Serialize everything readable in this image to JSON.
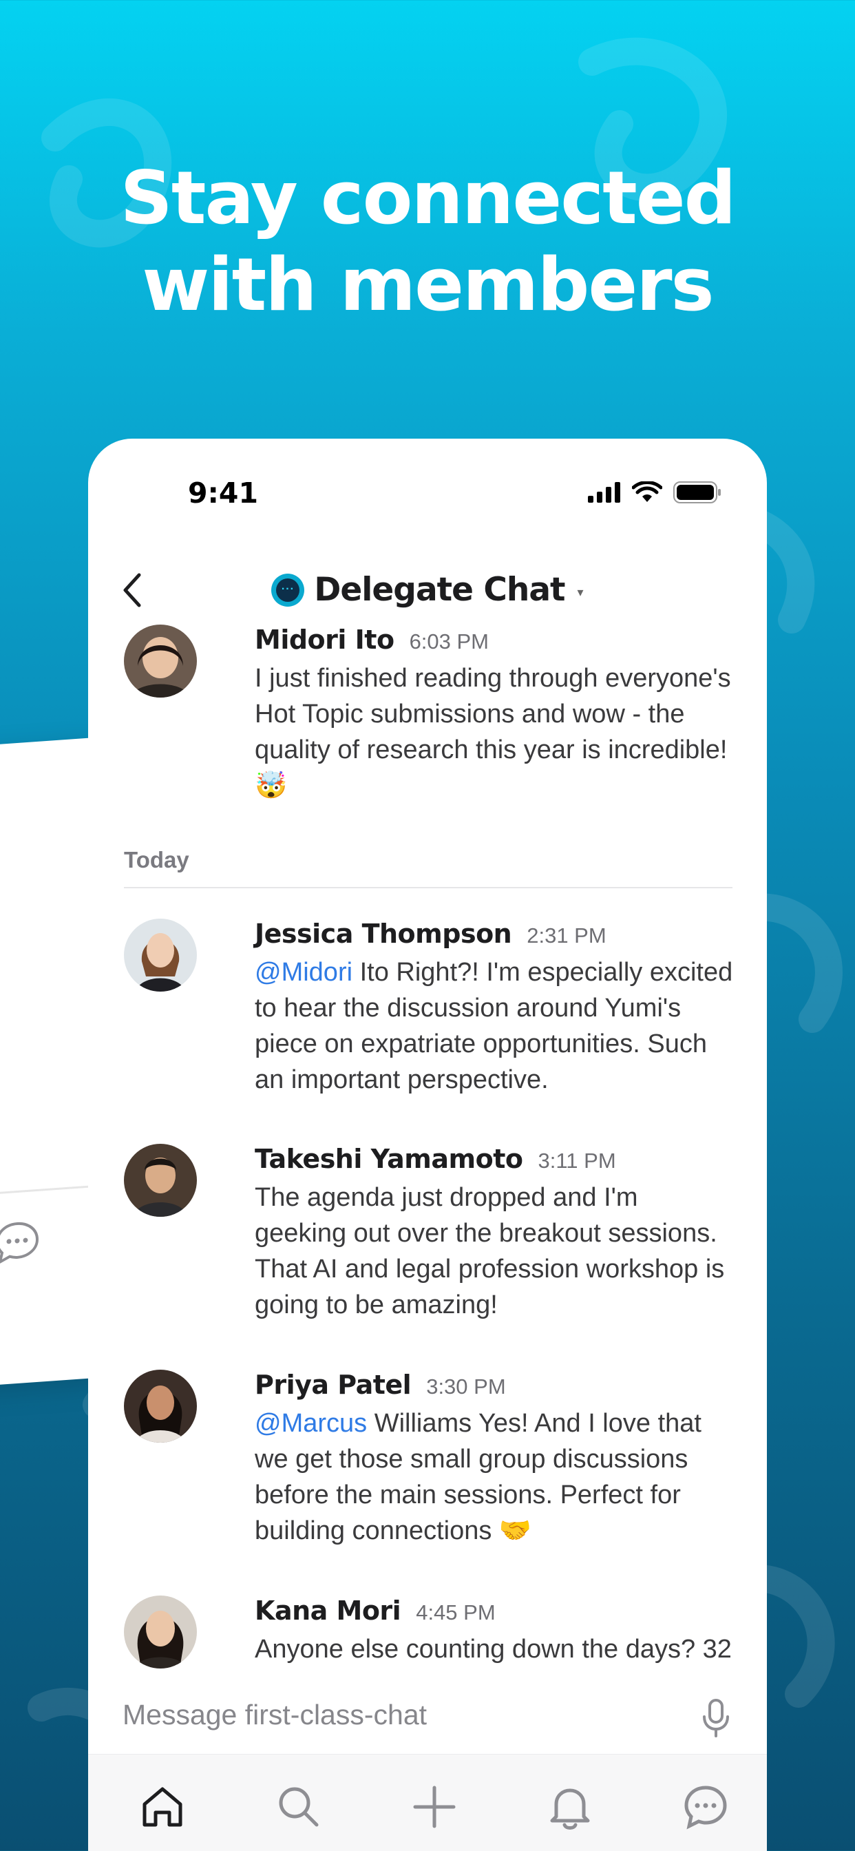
{
  "headline": {
    "line1": "Stay connected",
    "line2": "with members"
  },
  "status_bar": {
    "time": "9:41"
  },
  "chat": {
    "title": "Delegate Chat",
    "messages": [
      {
        "name": "Midori Ito",
        "time": "6:03 PM",
        "text": "I just finished reading through everyone's Hot Topic submissions and wow - the quality of research this year is incredible! 🤯"
      },
      {
        "name": "Jessica Thompson",
        "time": "2:31 PM",
        "mention": "@Midori",
        "text": " Ito Right?! I'm especially excited to hear the discussion around Yumi's piece on expatriate opportunities. Such an important perspective."
      },
      {
        "name": "Takeshi Yamamoto",
        "time": "3:11 PM",
        "text": "The agenda just dropped and I'm geeking out over the breakout sessions. That AI and legal profession workshop is going to be amazing!"
      },
      {
        "name": "Priya Patel",
        "time": "3:30 PM",
        "mention": "@Marcus",
        "text": " Williams Yes! And I love that we get those small group discussions before the main sessions. Perfect for building connections 🤝"
      },
      {
        "name": "Kana Mori",
        "time": "4:45 PM",
        "text": "Anyone else counting down the days? 32"
      }
    ],
    "day_separator": "Today"
  },
  "composer": {
    "placeholder": "Message first-class-chat"
  },
  "tabbar": {
    "items": [
      {
        "icon": "home-icon"
      },
      {
        "icon": "search-icon"
      },
      {
        "icon": "plus-icon"
      },
      {
        "icon": "bell-icon"
      },
      {
        "icon": "chat-bubble-icon"
      }
    ]
  },
  "colors": {
    "accent": "#2f7be5",
    "brand": "#04d2f1"
  }
}
